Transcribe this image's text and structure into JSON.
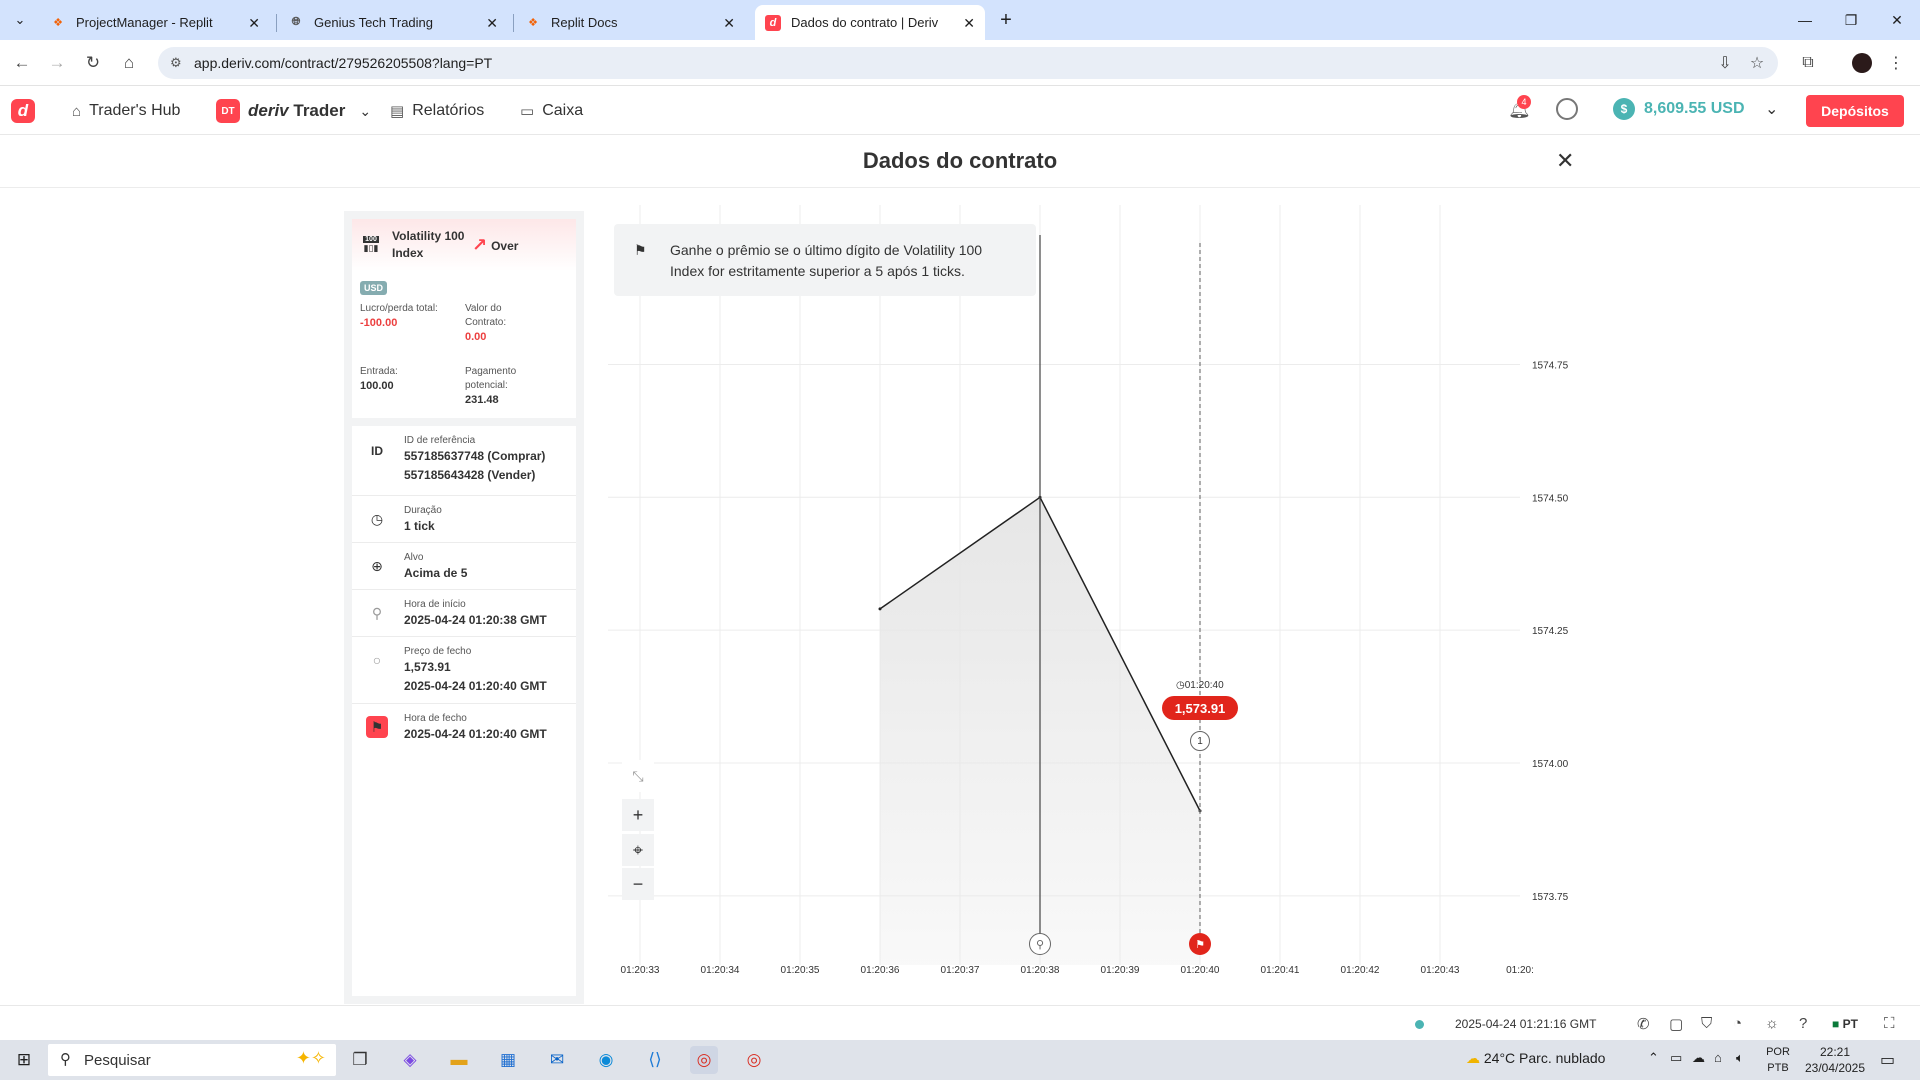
{
  "browser": {
    "tabs": [
      {
        "title": "ProjectManager - Replit"
      },
      {
        "title": "Genius Tech Trading"
      },
      {
        "title": "Replit Docs"
      },
      {
        "title": "Dados do contrato | Deriv"
      }
    ],
    "url": "app.deriv.com/contract/279526205508?lang=PT"
  },
  "header": {
    "traders_hub": "Trader's Hub",
    "brand_badge": "DT",
    "brand_bold": "deriv",
    "brand_rest": "Trader",
    "reports": "Relatórios",
    "cashier": "Caixa",
    "notification_count": "4",
    "balance": "8,609.55 USD",
    "deposit": "Depósitos"
  },
  "page": {
    "title": "Dados do contrato"
  },
  "summary": {
    "symbol": "Volatility 100 Index",
    "symbol_icon_text": "100",
    "contract_type": "Over",
    "currency": "USD",
    "total_pl_label": "Lucro/perda total:",
    "total_pl_value": "-100.00",
    "contract_value_label": "Valor do Contrato:",
    "contract_value": "0.00",
    "entry_label": "Entrada:",
    "entry_value": "100.00",
    "potential_payout_label": "Pagamento potencial:",
    "potential_payout": "231.48"
  },
  "details": {
    "ref_icon": "ID",
    "ref_label": "ID de referência",
    "ref_buy": "557185637748 (Comprar)",
    "ref_sell": "557185643428 (Vender)",
    "duration_label": "Duração",
    "duration_value": "1 tick",
    "target_label": "Alvo",
    "target_value": "Acima de 5",
    "start_label": "Hora de início",
    "start_value": "2025-04-24 01:20:38 GMT",
    "close_price_label": "Preço de fecho",
    "close_price_value": "1,573.91",
    "close_price_time": "2025-04-24 01:20:40 GMT",
    "close_time_label": "Hora de fecho",
    "close_time_value": "2025-04-24 01:20:40 GMT"
  },
  "chart_info": {
    "description": "Ganhe o prêmio se o último dígito de Volatility 100 Index for estritamente superior a 5 após 1 ticks.",
    "current_price": "1,573.91",
    "exit_time_label": "01:20:40",
    "tick_number": "1"
  },
  "chart_data": {
    "type": "area",
    "x": [
      "01:20:36",
      "01:20:38",
      "01:20:40"
    ],
    "y": [
      1574.29,
      1574.5,
      1573.91
    ],
    "x_ticks": [
      "01:20:33",
      "01:20:34",
      "01:20:35",
      "01:20:36",
      "01:20:37",
      "01:20:38",
      "01:20:39",
      "01:20:40",
      "01:20:41",
      "01:20:42",
      "01:20:43",
      "01:20:"
    ],
    "y_ticks": [
      "1574.75",
      "1574.50",
      "1574.25",
      "1574.00",
      "1573.75"
    ],
    "ylim": [
      1573.62,
      1575.05
    ],
    "grid": true,
    "line_color": "#222222",
    "fill_color": "#e6e6e6",
    "entry_time": "01:20:38",
    "exit_time": "01:20:40"
  },
  "footer": {
    "server_time": "2025-04-24 01:21:16 GMT",
    "language": "PT"
  },
  "taskbar": {
    "search_placeholder": "Pesquisar",
    "weather": "24°C  Parc. nublado",
    "lang_top": "POR",
    "lang_bottom": "PTB",
    "time": "22:21",
    "date": "23/04/2025"
  }
}
